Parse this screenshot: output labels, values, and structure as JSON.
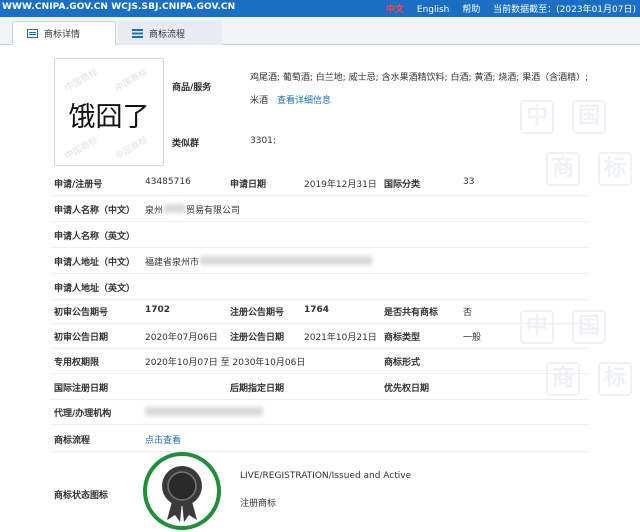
{
  "topbar": {
    "site": "WWW.CNIPA.GOV.CN WCJS.SBJ.CNIPA.GOV.CN",
    "lang_cn": "中文",
    "lang_en": "English",
    "help": "帮助",
    "data_cutoff": "当前数据截至：(2023年01月07日)"
  },
  "tabs": [
    {
      "label": "商标详情"
    },
    {
      "label": "商标流程"
    }
  ],
  "mark": {
    "image_text": "饿囧了",
    "watermark_text": "中国商标"
  },
  "goods": {
    "label": "商品/服务",
    "value_line1": "鸡尾酒; 葡萄酒; 白兰地; 威士忌; 含水果酒精饮料; 白酒; 黄酒; 烧酒; 果酒（含酒精）;",
    "value_line2": "米酒",
    "detail_link": "查看详细信息"
  },
  "similar_group": {
    "label": "类似群",
    "value": "3301;"
  },
  "fields": {
    "reg_no_label": "申请/注册号",
    "reg_no": "43485716",
    "app_date_label": "申请日期",
    "app_date": "2019年12月31日",
    "class_label": "国际分类",
    "class_value": "33",
    "applicant_cn_label": "申请人名称（中文）",
    "applicant_cn_prefix": "泉州",
    "applicant_cn_suffix": "贸易有限公司",
    "applicant_en_label": "申请人名称（英文）",
    "address_cn_label": "申请人地址（中文）",
    "address_cn_prefix": "福建省泉州市",
    "address_en_label": "申请人地址（英文）",
    "prelim_no_label": "初审公告期号",
    "prelim_no": "1702",
    "reg_pub_no_label": "注册公告期号",
    "reg_pub_no": "1764",
    "shared_label": "是否共有商标",
    "shared_value": "否",
    "prelim_date_label": "初审公告日期",
    "prelim_date": "2020年07月06日",
    "reg_pub_date_label": "注册公告日期",
    "reg_pub_date": "2021年10月21日",
    "type_label": "商标类型",
    "type_value": "一般",
    "exclusive_label": "专用权期限",
    "exclusive_value": "2020年10月07日 至 2030年10月06日",
    "form_label": "商标形式",
    "intl_reg_date_label": "国际注册日期",
    "later_date_label": "后期指定日期",
    "priority_date_label": "优先权日期",
    "agent_label": "代理/办理机构",
    "process_label": "商标流程",
    "process_link": "点击查看",
    "status_icon_label": "商标状态图标",
    "status_en": "LIVE/REGISTRATION/Issued and Active",
    "status_cn": "注册商标"
  },
  "watermark_chars": [
    "中",
    "国",
    "商",
    "标"
  ],
  "colors": {
    "brand_blue": "#1a6fc4",
    "status_green": "#1f8f3a"
  }
}
